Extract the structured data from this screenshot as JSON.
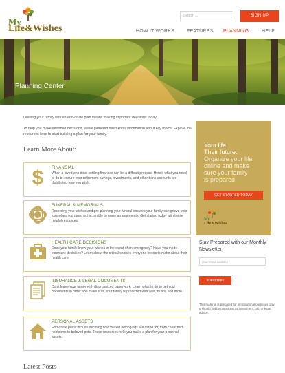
{
  "brand": {
    "logo_line1": "My",
    "logo_line2": "Life&Wishes",
    "colors": {
      "accent": "#e8451c",
      "gold": "#c7aa5a",
      "green": "#5d7a2f"
    }
  },
  "header": {
    "search_placeholder": "Search ...",
    "signup_label": "SIGN UP",
    "nav": [
      {
        "label": "HOW IT WORKS",
        "active": false
      },
      {
        "label": "FEATURES",
        "active": false
      },
      {
        "label": "PLANNING",
        "active": true
      },
      {
        "label": "HELP",
        "active": false
      }
    ]
  },
  "hero": {
    "title": "Planning Center"
  },
  "main": {
    "intro1": "Leaving your family with an end-of-life plan means making important decisions today.",
    "intro2": "To help you make informed decisions, we've gathered must-know information about key topics. Explore the resources here to start building a plan for your family.",
    "learn_title": "Learn More About:",
    "cards": [
      {
        "title": "FINANCIAL",
        "icon": "dollar-icon",
        "desc": "When a loved one dies, settling finances can be a difficult process. Here's what you need to do to ensure your retirement savings, investments, and other bank accounts are distributed how you wish."
      },
      {
        "title": "FUNERAL & MEMORIALS",
        "icon": "flower-icon",
        "desc": "Recording your wishes and pre-planning your funeral ensures your family can grieve your loss when you pass, not scramble to make arrangements. Get started today with these helpful resources."
      },
      {
        "title": "HEALTH CARE DECISIONS",
        "icon": "medical-kit-icon",
        "desc": "Does your family know your wishes in the event of an emergency? Have you made eldercare decisions? Learn about the critical choices everyone needs to make about their health care."
      },
      {
        "title": "INSURANCE & LEGAL DOCUMENTS",
        "icon": "documents-icon",
        "desc": "Don't leave your family with disorganized paperwork. Learn what to do to get your documents in order and make sure your family is protected with wills, trusts, and more."
      },
      {
        "title": "PERSONAL ASSETS",
        "icon": "house-icon",
        "desc": "End-of-life plans include deciding how valued belongings are cared for, from cherished heirlooms to beloved pets. These resources help you make a plan for your personal assets."
      }
    ],
    "latest_title": "Latest Posts"
  },
  "sidebar": {
    "promo_lines": [
      "Your life.",
      "Their future.",
      "Organize your life",
      "online and make",
      "sure your family",
      "is prepared."
    ],
    "cta_label": "GET STARTED TODAY",
    "newsletter_title": "Stay Prepared with our Monthly Newsletter",
    "email_placeholder": "your email address",
    "subscribe_label": "SUBSCRIBE",
    "disclaimer": "This material is prepared for informational purposes only. It should not be construed as investment, tax, or legal advice."
  }
}
